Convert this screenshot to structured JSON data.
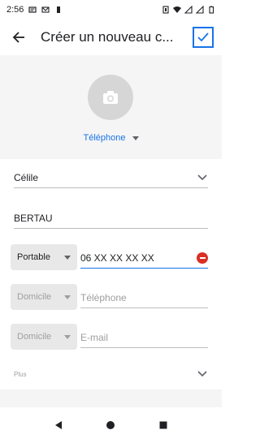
{
  "status_bar": {
    "time": "2:56",
    "left_icons": [
      "notification-message-icon",
      "gmail-icon",
      "battery-small-icon"
    ],
    "right_icons": [
      "vibrate-icon",
      "wifi-icon",
      "signal-icon",
      "battery-icon"
    ]
  },
  "app_bar": {
    "title": "Créer un nouveau c...",
    "back_icon": "arrow-left-icon",
    "confirm_icon": "check-icon",
    "accent": "#1a73e8"
  },
  "header": {
    "photo_icon": "camera-icon",
    "account_label": "Téléphone"
  },
  "form": {
    "first_name": "Célile",
    "last_name": "BERTAU",
    "phone_type": "Portable",
    "phone_value": "06 XX XX XX XX",
    "phone2_type": "Domicile",
    "phone2_placeholder": "Téléphone",
    "email_type": "Domicile",
    "email_placeholder": "E-mail",
    "more_label": "Plus"
  },
  "colors": {
    "remove": "#d93025",
    "header_bg": "#f5f5f5"
  }
}
